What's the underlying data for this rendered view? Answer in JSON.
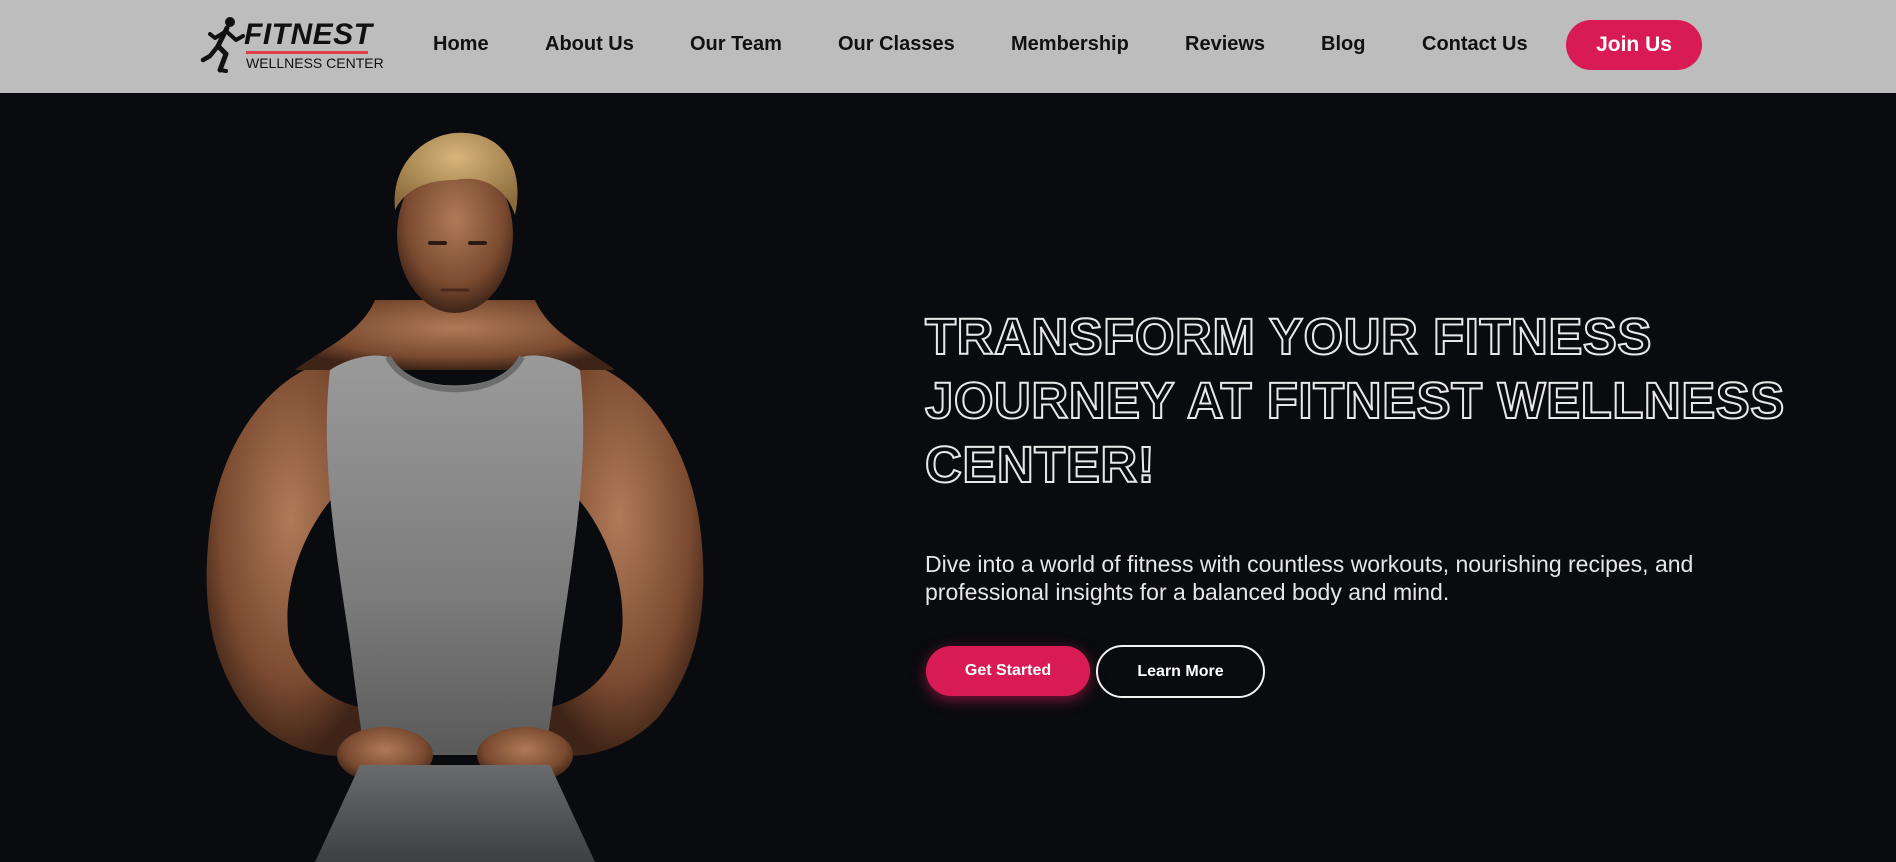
{
  "colors": {
    "nav_bg": "#bdbdbd",
    "hero_bg": "#0a0b0f",
    "accent": "#d81b55",
    "logo_bar": "#e23b4a"
  },
  "logo": {
    "brand": "FITNEST",
    "subtitle": "WELLNESS CENTER",
    "icon": "runner-icon"
  },
  "nav": {
    "links": [
      {
        "label": "Home"
      },
      {
        "label": "About Us"
      },
      {
        "label": "Our Team"
      },
      {
        "label": "Our Classes"
      },
      {
        "label": "Membership"
      },
      {
        "label": "Reviews"
      },
      {
        "label": "Blog"
      },
      {
        "label": "Contact Us"
      }
    ],
    "cta": "Join Us"
  },
  "hero": {
    "headline": "TRANSFORM YOUR FITNESS JOURNEY AT FITNEST WELLNESS CENTER!",
    "description": "Dive into a world of fitness with countless workouts, nourishing recipes, and professional insights for a balanced body and mind.",
    "primary_button": "Get Started",
    "secondary_button": "Learn More",
    "image": "muscular-man-portrait"
  }
}
